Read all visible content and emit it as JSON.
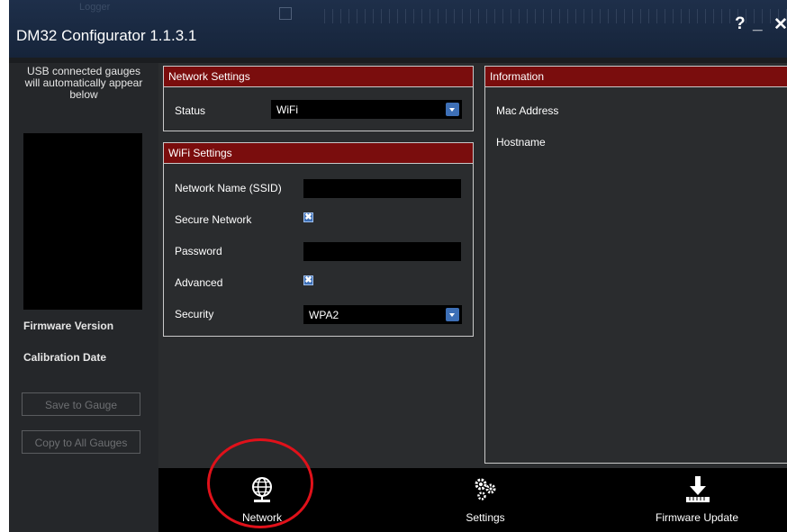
{
  "window": {
    "title": "DM32 Configurator 1.1.3.1",
    "background_word": "Logger",
    "help_label": "?",
    "minimize_label": "_",
    "close_label": "✕"
  },
  "left_panel": {
    "usb_note": "USB connected gauges will automatically appear below",
    "firmware_version_label": "Firmware Version",
    "calibration_date_label": "Calibration Date",
    "save_button": "Save to Gauge",
    "copy_button": "Copy to All Gauges"
  },
  "network_settings": {
    "title": "Network Settings",
    "status_label": "Status",
    "status_value": "WiFi"
  },
  "wifi_settings": {
    "title": "WiFi Settings",
    "ssid_label": "Network Name (SSID)",
    "ssid_value": "",
    "secure_label": "Secure Network",
    "secure_checked": true,
    "password_label": "Password",
    "password_value": "",
    "advanced_label": "Advanced",
    "advanced_checked": true,
    "security_label": "Security",
    "security_value": "WPA2",
    "check_mark": "✖"
  },
  "information": {
    "title": "Information",
    "mac_label": "Mac Address",
    "hostname_label": "Hostname"
  },
  "nav": {
    "network": "Network",
    "settings": "Settings",
    "firmware_update": "Firmware Update"
  },
  "colors": {
    "header_red": "#7a0d0d",
    "checkbox_blue": "#3d6fb6",
    "annotation_red": "#e0111a"
  }
}
